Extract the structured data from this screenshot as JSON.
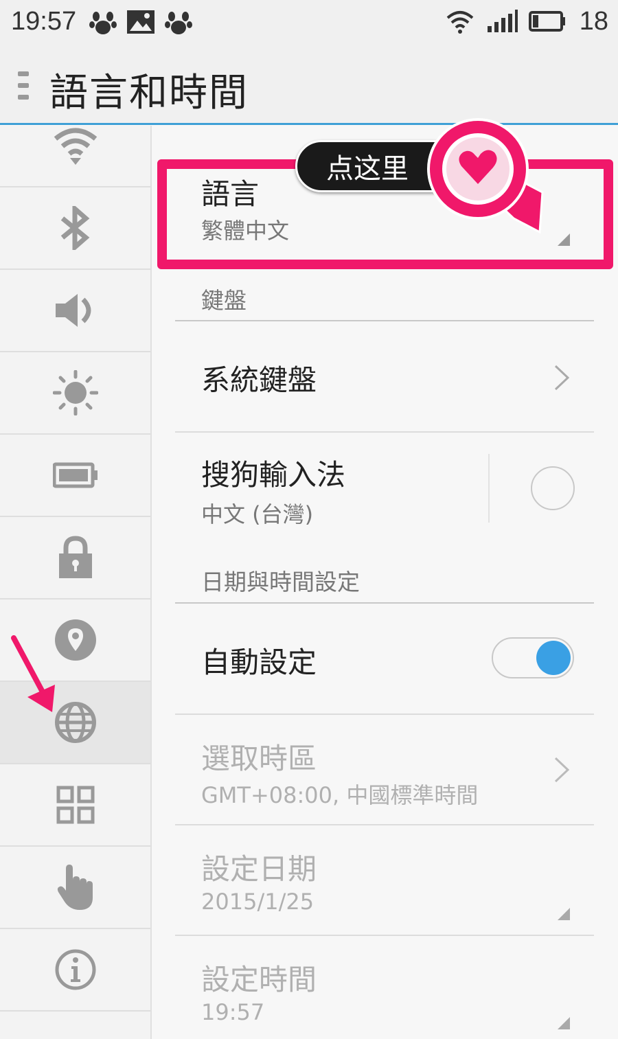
{
  "status_bar": {
    "time": "19:57",
    "battery_level": "18",
    "icons": [
      "baidu-paw-icon",
      "image-icon",
      "baidu-paw-icon",
      "wifi-icon",
      "signal-icon",
      "battery-icon"
    ]
  },
  "header": {
    "title": "語言和時間",
    "menu_icon": "menu-icon"
  },
  "sidebar": {
    "items": [
      {
        "icon": "wifi-icon"
      },
      {
        "icon": "bluetooth-icon"
      },
      {
        "icon": "sound-icon"
      },
      {
        "icon": "brightness-icon"
      },
      {
        "icon": "battery-icon"
      },
      {
        "icon": "lock-icon"
      },
      {
        "icon": "location-icon"
      },
      {
        "icon": "globe-icon",
        "active": true
      },
      {
        "icon": "apps-icon"
      },
      {
        "icon": "touch-icon"
      },
      {
        "icon": "info-icon"
      }
    ]
  },
  "language": {
    "title": "語言",
    "value": "繁體中文"
  },
  "keyboard_section": "鍵盤",
  "system_keyboard": {
    "title": "系統鍵盤"
  },
  "sogou": {
    "title": "搜狗輸入法",
    "sub": "中文 (台灣)"
  },
  "datetime_section": "日期與時間設定",
  "auto_set": {
    "title": "自動設定",
    "on": true
  },
  "timezone": {
    "title": "選取時區",
    "sub": "GMT+08:00, 中國標準時間"
  },
  "set_date": {
    "title": "設定日期",
    "sub": "2015/1/25"
  },
  "set_time": {
    "title": "設定時間",
    "sub": "19:57"
  },
  "annotation": {
    "tooltip": "点这里",
    "highlight_color": "#f0186a",
    "arrow_color": "#f0186a"
  },
  "colors": {
    "accent": "#3fa0d6",
    "toggle_on": "#3aa0e4"
  }
}
